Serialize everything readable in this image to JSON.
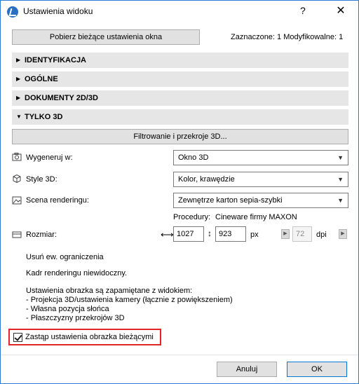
{
  "window": {
    "title": "Ustawienia widoku",
    "help_symbol": "?",
    "close_symbol": "✕"
  },
  "top": {
    "fetch_button": "Pobierz bieżące ustawienia okna",
    "status": "Zaznaczone: 1 Modyfikowalne: 1"
  },
  "sections": [
    {
      "label": "IDENTYFIKACJA",
      "expanded": false
    },
    {
      "label": "OGÓLNE",
      "expanded": false
    },
    {
      "label": "DOKUMENTY 2D/3D",
      "expanded": false
    },
    {
      "label": "TYLKO 3D",
      "expanded": true
    }
  ],
  "only3d": {
    "filter_button": "Filtrowanie i przekroje 3D...",
    "generate_label": "Wygeneruj w:",
    "generate_value": "Okno 3D",
    "style_label": "Style 3D:",
    "style_value": "Kolor, krawędzie",
    "scene_label": "Scena renderingu:",
    "scene_value": "Zewnętrze karton sepia-szybki",
    "procedure_label": "Procedury:",
    "procedure_value": "Cineware firmy MAXON",
    "size_label": "Rozmiar:",
    "width": "1027",
    "height": "923",
    "unit": "px",
    "dpi_value": "72",
    "dpi_label": "dpi",
    "note_limits": "Usuń ew. ograniczenia",
    "note_frame": "Kadr renderingu niewidoczny.",
    "note_saved_title": "Ustawienia obrazka są zapamiętane z widokiem:",
    "note_saved_items": [
      "- Projekcja 3D/ustawienia kamery (łącznie z powiększeniem)",
      "- Własna pozycja słońca",
      "- Płaszczyzny przekrojów 3D"
    ],
    "replace_label": "Zastąp ustawienia obrazka bieżącymi",
    "replace_checked": true
  },
  "footer": {
    "cancel": "Anuluj",
    "ok": "OK"
  }
}
